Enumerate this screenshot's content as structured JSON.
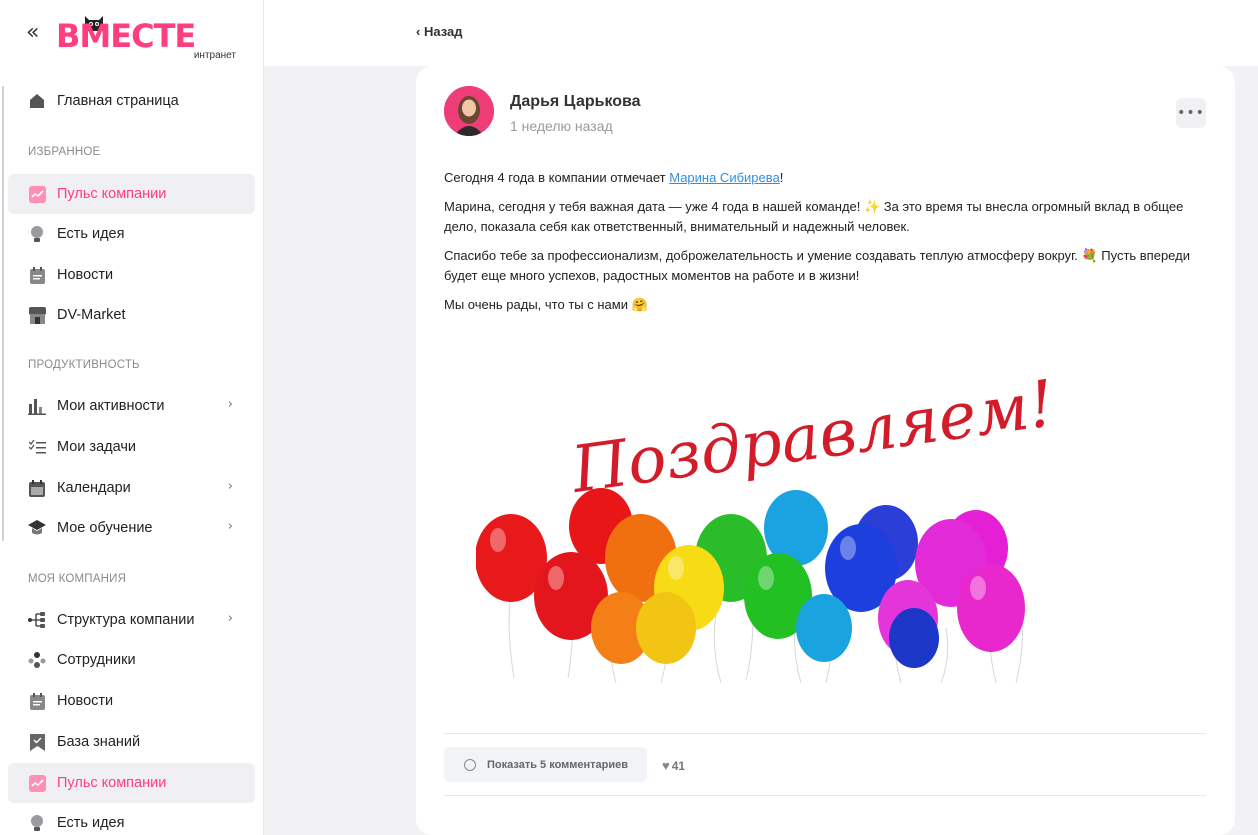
{
  "app": {
    "logo_text": "ВМЕСТЕ",
    "logo_subtitle": "интранет",
    "collapse_icon": "double-chevron-left-icon",
    "accent_color": "#ff3d7f"
  },
  "sidebar": {
    "top": [
      {
        "label": "Главная страница",
        "icon": "home-icon"
      }
    ],
    "sections": [
      {
        "title": "ИЗБРАННОЕ"
      },
      {
        "title": "ПРОДУКТИВНОСТЬ"
      },
      {
        "title": "МОЯ КОМПАНИЯ"
      }
    ],
    "favorites": [
      {
        "label": "Пульс компании",
        "icon": "pulse-icon",
        "active": true
      },
      {
        "label": "Есть идея",
        "icon": "lightbulb-icon"
      },
      {
        "label": "Новости",
        "icon": "news-icon"
      },
      {
        "label": "DV-Market",
        "icon": "shop-icon"
      }
    ],
    "productivity": [
      {
        "label": "Мои активности",
        "icon": "bar-chart-icon",
        "has_submenu": true
      },
      {
        "label": "Мои задачи",
        "icon": "tasks-icon"
      },
      {
        "label": "Календари",
        "icon": "calendar-icon",
        "has_submenu": true
      },
      {
        "label": "Мое обучение",
        "icon": "graduation-cap-icon",
        "has_submenu": true
      }
    ],
    "company": [
      {
        "label": "Структура компании",
        "icon": "org-structure-icon",
        "has_submenu": true
      },
      {
        "label": "Сотрудники",
        "icon": "employees-icon"
      },
      {
        "label": "Новости",
        "icon": "news-icon"
      },
      {
        "label": "База знаний",
        "icon": "bookmark-icon"
      },
      {
        "label": "Пульс компании",
        "icon": "pulse-icon",
        "active": true
      },
      {
        "label": "Есть идея",
        "icon": "lightbulb-icon"
      }
    ]
  },
  "topbar": {
    "back_label": "Назад"
  },
  "post": {
    "author": "Дарья Царькова",
    "time": "1 неделю назад",
    "more_label": "•••",
    "p1_before": "Сегодня 4 года в компании отмечает ",
    "p1_link": "Марина Сибирева",
    "p1_after": "!",
    "p2": "Марина, сегодня у тебя важная дата — уже 4 года в нашей команде! ✨ За это время ты внесла огромный вклад в общее дело, показала себя как ответственный, внимательный и надежный человек.",
    "p3": "Спасибо тебе за профессионализм, доброжелательность и умение создавать теплую атмосферу вокруг. 💐 Пусть впереди будет еще много успехов, радостных моментов на работе и в жизни!",
    "p4": "Мы очень рады, что ты с нами 🤗",
    "image_caption": "Поздравляем!",
    "comments_button": "Показать 5 комментариев",
    "likes": "41"
  }
}
